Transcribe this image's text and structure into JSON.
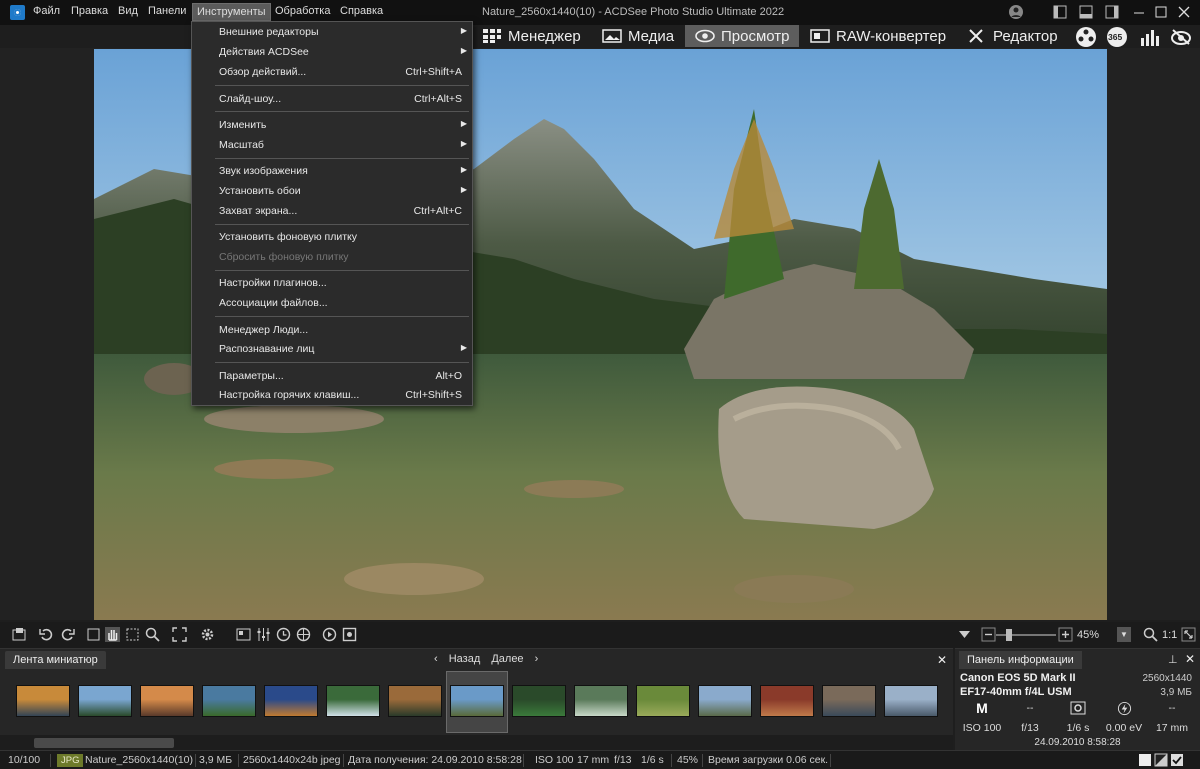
{
  "menu": {
    "items": [
      "Файл",
      "Правка",
      "Вид",
      "Панели",
      "Инструменты",
      "Обработка",
      "Справка"
    ],
    "active": "Инструменты"
  },
  "window": {
    "title": "Nature_2560x1440(10) - ACDSee Photo Studio Ultimate 2022"
  },
  "modes": {
    "tabs": [
      "Менеджер",
      "Медиа",
      "Просмотр",
      "RAW-конвертер",
      "Редактор"
    ],
    "active": "Просмотр",
    "badge_365": "365"
  },
  "dropdown": {
    "items": [
      {
        "label": "Внешние редакторы",
        "shortcut": "",
        "submenu": true
      },
      {
        "label": "Действия ACDSee",
        "shortcut": "",
        "submenu": true
      },
      {
        "label": "Обзор действий...",
        "shortcut": "Ctrl+Shift+A",
        "submenu": false
      },
      {
        "label": "Слайд-шоу...",
        "shortcut": "Ctrl+Alt+S",
        "submenu": false
      },
      {
        "label": "Изменить",
        "shortcut": "",
        "submenu": true
      },
      {
        "label": "Масштаб",
        "shortcut": "",
        "submenu": true
      },
      {
        "label": "Звук изображения",
        "shortcut": "",
        "submenu": true
      },
      {
        "label": "Установить обои",
        "shortcut": "",
        "submenu": true
      },
      {
        "label": "Захват экрана...",
        "shortcut": "Ctrl+Alt+C",
        "submenu": false
      },
      {
        "label": "Установить фоновую плитку",
        "shortcut": "",
        "submenu": false
      },
      {
        "label": "Сбросить фоновую плитку",
        "shortcut": "",
        "submenu": false,
        "disabled": true
      },
      {
        "label": "Настройки плагинов...",
        "shortcut": "",
        "submenu": false
      },
      {
        "label": "Ассоциации файлов...",
        "shortcut": "",
        "submenu": false
      },
      {
        "label": "Менеджер Люди...",
        "shortcut": "",
        "submenu": false
      },
      {
        "label": "Распознавание лиц",
        "shortcut": "",
        "submenu": true
      },
      {
        "label": "Параметры...",
        "shortcut": "Alt+O",
        "submenu": false
      },
      {
        "label": "Настройка горячих клавиш...",
        "shortcut": "Ctrl+Shift+S",
        "submenu": false
      }
    ],
    "submenu_arrow": "▶"
  },
  "toolbar": {
    "zoom": "45%",
    "ratio": "1:1",
    "zoom_arrow": "▼"
  },
  "filmstrip": {
    "tab_label": "Лента миниатюр",
    "back": "Назад",
    "next": "Далее",
    "close": "✕",
    "selected_index": 7,
    "thumb_count": 15
  },
  "info": {
    "tab_label": "Панель информации",
    "pin": "📌",
    "close": "✕",
    "camera_model": "Canon EOS 5D Mark II",
    "lens": "EF17-40mm f/4L USM",
    "dimensions": "2560x1440",
    "file_size": "3,9 МБ",
    "mode": "M",
    "dash1": "--",
    "dash2": "--",
    "iso": "ISO 100",
    "aperture": "f/13",
    "shutter": "1/6 s",
    "exposure_comp": "0.00 eV",
    "focal": "17 mm",
    "date": "24.09.2010 8:58:28"
  },
  "status": {
    "position": "10/100",
    "type": "JPG",
    "filename": "Nature_2560x1440(10)",
    "size": "3,9 МБ",
    "dims": "2560x1440x24b jpeg",
    "date": "Дата получения: 24.09.2010 8:58:28",
    "iso": "ISO 100",
    "focal": "17 mm",
    "aperture": "f/13",
    "shutter": "1/6 s",
    "zoom": "45%",
    "load": "Время загрузки 0.06 сек."
  },
  "colors": {
    "accent": "#1f7ac9",
    "active_tab": "#5d5d5d",
    "badge_jpg": "#6d7a2a"
  }
}
